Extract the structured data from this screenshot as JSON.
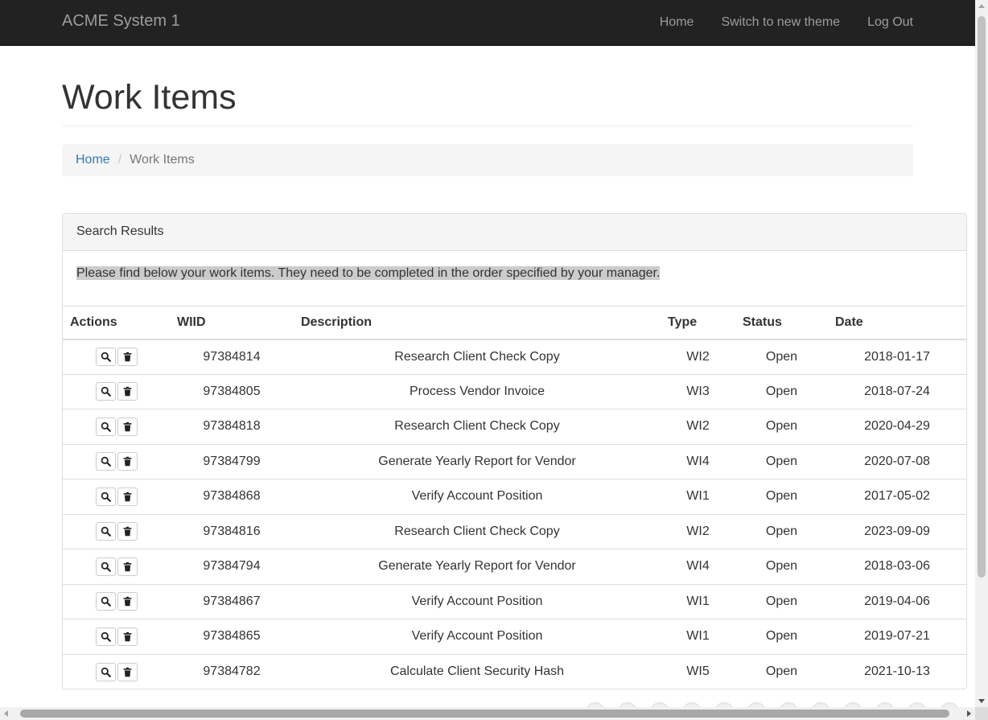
{
  "nav": {
    "brand": "ACME System 1",
    "links": [
      "Home",
      "Switch to new theme",
      "Log Out"
    ]
  },
  "page": {
    "title": "Work Items"
  },
  "breadcrumb": {
    "home": "Home",
    "current": "Work Items"
  },
  "panel": {
    "heading": "Search Results",
    "intro": "Please find below your work items. They need to be completed in the order specified by your manager."
  },
  "table": {
    "headers": [
      "Actions",
      "WIID",
      "Description",
      "Type",
      "Status",
      "Date"
    ],
    "rows": [
      {
        "wiid": "97384814",
        "description": "Research Client Check Copy",
        "type": "WI2",
        "status": "Open",
        "date": "2018-01-17"
      },
      {
        "wiid": "97384805",
        "description": "Process Vendor Invoice",
        "type": "WI3",
        "status": "Open",
        "date": "2018-07-24"
      },
      {
        "wiid": "97384818",
        "description": "Research Client Check Copy",
        "type": "WI2",
        "status": "Open",
        "date": "2020-04-29"
      },
      {
        "wiid": "97384799",
        "description": "Generate Yearly Report for Vendor",
        "type": "WI4",
        "status": "Open",
        "date": "2020-07-08"
      },
      {
        "wiid": "97384868",
        "description": "Verify Account Position",
        "type": "WI1",
        "status": "Open",
        "date": "2017-05-02"
      },
      {
        "wiid": "97384816",
        "description": "Research Client Check Copy",
        "type": "WI2",
        "status": "Open",
        "date": "2023-09-09"
      },
      {
        "wiid": "97384794",
        "description": "Generate Yearly Report for Vendor",
        "type": "WI4",
        "status": "Open",
        "date": "2018-03-06"
      },
      {
        "wiid": "97384867",
        "description": "Verify Account Position",
        "type": "WI1",
        "status": "Open",
        "date": "2019-04-06"
      },
      {
        "wiid": "97384865",
        "description": "Verify Account Position",
        "type": "WI1",
        "status": "Open",
        "date": "2019-07-21"
      },
      {
        "wiid": "97384782",
        "description": "Calculate Client Security Hash",
        "type": "WI5",
        "status": "Open",
        "date": "2021-10-13"
      }
    ]
  },
  "icons": {
    "view": "search-icon",
    "delete": "trash-icon"
  },
  "colors": {
    "navbar": "#222222",
    "link": "#337ab7",
    "highlight": "#cccccc"
  }
}
